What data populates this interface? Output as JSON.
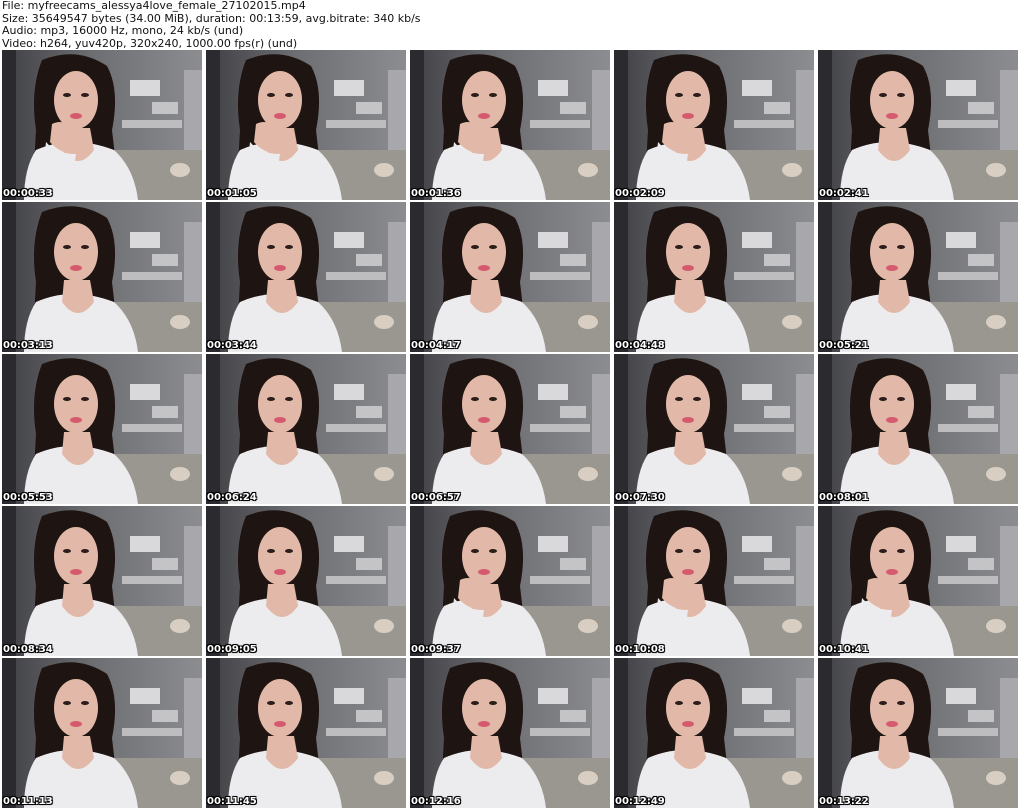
{
  "header": {
    "file_line": "File: myfreecams_alessya4love_female_27102015.mp4",
    "size_line": "Size: 35649547 bytes (34.00 MiB), duration: 00:13:59, avg.bitrate: 340 kb/s",
    "audio_line": "Audio: mp3, 16000 Hz, mono, 24 kb/s (und)",
    "video_line": "Video: h264, yuv420p, 320x240, 1000.00 fps(r) (und)"
  },
  "thumbnails": [
    {
      "timestamp": "00:00:33",
      "pose": "hand"
    },
    {
      "timestamp": "00:01:05",
      "pose": "hand"
    },
    {
      "timestamp": "00:01:36",
      "pose": "hand"
    },
    {
      "timestamp": "00:02:09",
      "pose": "hand"
    },
    {
      "timestamp": "00:02:41",
      "pose": "front"
    },
    {
      "timestamp": "00:03:13",
      "pose": "front"
    },
    {
      "timestamp": "00:03:44",
      "pose": "front"
    },
    {
      "timestamp": "00:04:17",
      "pose": "front"
    },
    {
      "timestamp": "00:04:48",
      "pose": "front"
    },
    {
      "timestamp": "00:05:21",
      "pose": "front"
    },
    {
      "timestamp": "00:05:53",
      "pose": "front"
    },
    {
      "timestamp": "00:06:24",
      "pose": "front"
    },
    {
      "timestamp": "00:06:57",
      "pose": "front"
    },
    {
      "timestamp": "00:07:30",
      "pose": "front"
    },
    {
      "timestamp": "00:08:01",
      "pose": "front"
    },
    {
      "timestamp": "00:08:34",
      "pose": "front"
    },
    {
      "timestamp": "00:09:05",
      "pose": "front"
    },
    {
      "timestamp": "00:09:37",
      "pose": "hand"
    },
    {
      "timestamp": "00:10:08",
      "pose": "hand"
    },
    {
      "timestamp": "00:10:41",
      "pose": "hand"
    },
    {
      "timestamp": "00:11:13",
      "pose": "front"
    },
    {
      "timestamp": "00:11:45",
      "pose": "front"
    },
    {
      "timestamp": "00:12:16",
      "pose": "front"
    },
    {
      "timestamp": "00:12:49",
      "pose": "front"
    },
    {
      "timestamp": "00:13:22",
      "pose": "front"
    }
  ],
  "colors": {
    "background": "#ffffff",
    "wall": "#6d6e72",
    "wall_dark": "#3f3f44",
    "shelf": "#d9d9db",
    "sofa": "#9a9690",
    "hair": "#1e1412",
    "skin": "#e2b9a8",
    "shirt": "#ececee",
    "lips": "#d55a6e"
  }
}
